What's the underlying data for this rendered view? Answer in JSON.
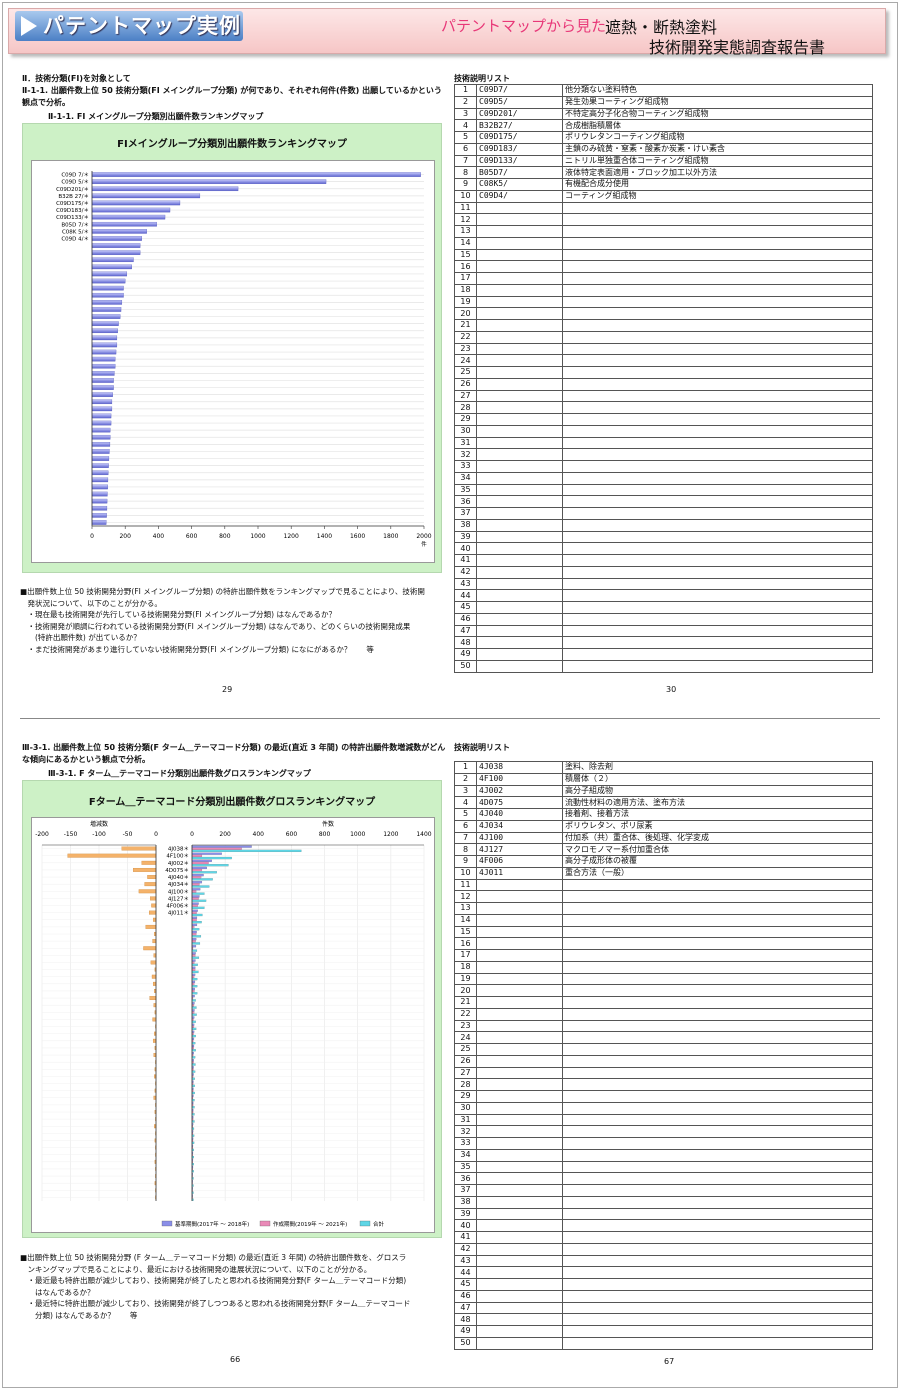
{
  "header": {
    "brand": "パテントマップ実例",
    "subtitle": "パテントマップから見た",
    "title_line1": "遮熱・断熱塗料",
    "title_line2": "技術開発実態調査報告書"
  },
  "page1": {
    "heading": "Ⅱ．技術分類(FI)を対象として",
    "desc": "Ⅱ-1-1. 出願件数上位 50 技術分類(FI メイングループ分類) が何であり、それぞれ何件(件数) 出願しているかという観点で分析。",
    "sub": "Ⅱ-1-1. FI メイングループ分類別出願件数ランキングマップ",
    "chart_title": "FIメイングループ分類別出願件数ランキングマップ",
    "notes": [
      "■出願件数上位 50 技術開発分野(FI メイングループ分類) の特許出願件数をランキングマップで見ることにより、技術開",
      "　発状況について、以下のことが分かる。",
      "　・現在最も技術開発が先行している技術開発分野(FI メイングループ分類) はなんであるか？",
      "　・技術開発が順調に行われている技術開発分野(FI メイングループ分類) はなんであり、どのくらいの技術開発成果",
      "　　(特許出願件数) が出ているか？",
      "　・まだ技術開発があまり進行していない技術開発分野(FI メイングループ分類) になにがあるか？　　等"
    ],
    "page_left": "29",
    "page_right": "30",
    "table_label": "技術説明リスト",
    "rows": [
      [
        "1",
        "C09D7/",
        "他分類ない塗料特色"
      ],
      [
        "2",
        "C09D5/",
        "発生効果コーティング組成物"
      ],
      [
        "3",
        "C09D201/",
        "不特定高分子化合物コーティング組成物"
      ],
      [
        "4",
        "B32B27/",
        "合成樹脂積層体"
      ],
      [
        "5",
        "C09D175/",
        "ポリウレタンコーティング組成物"
      ],
      [
        "6",
        "C09D183/",
        "主鎖のみ硫黄・窒素・酸素か炭素・けい素含"
      ],
      [
        "7",
        "C09D133/",
        "ニトリル単独重合体コーティング組成物"
      ],
      [
        "8",
        "B05D7/",
        "液体特定表面適用・ブロック加工以外方法"
      ],
      [
        "9",
        "C08K5/",
        "有機配合成分使用"
      ],
      [
        "10",
        "C09D4/",
        "コーティング組成物"
      ]
    ]
  },
  "page2": {
    "desc": "Ⅲ-3-1. 出願件数上位 50 技術分類(F ターム＿テーマコード分類) の最近(直近 3 年間) の特許出願件数増減数がどんな傾向にあるかという観点で分析。",
    "sub": "Ⅲ-3-1. F ターム＿テーマコード分類別出願件数グロスランキングマップ",
    "chart_title": "Fターム＿テーマコード分類別出願件数グロスランキングマップ",
    "notes": [
      "■出願件数上位 50 技術開発分野 (F ターム＿テーマコード分類) の最近(直近 3 年間) の特許出願件数を、グロスラ",
      "　ンキングマップで見ることにより、最近における技術開発の進展状況について、以下のことが分かる。",
      "　・最近最も特許出願が減少しており、技術開発が終了したと思われる技術開発分野(F ターム＿テーマコード分類)",
      "　　はなんであるか？",
      "　・最近特に特許出願が減少しており、技術開発が終了しつつあると思われる技術開発分野(F ターム＿テーマコード",
      "　　分類) はなんであるか？　　等"
    ],
    "page_left": "66",
    "page_right": "67",
    "table_label": "技術説明リスト",
    "rows": [
      [
        "1",
        "4J038",
        "塗料、除去剤"
      ],
      [
        "2",
        "4F100",
        "積層体（２）"
      ],
      [
        "3",
        "4J002",
        "高分子組成物"
      ],
      [
        "4",
        "4D075",
        "流動性材料の適用方法、塗布方法"
      ],
      [
        "5",
        "4J040",
        "接着剤、接着方法"
      ],
      [
        "6",
        "4J034",
        "ポリウレタン、ポリ尿素"
      ],
      [
        "7",
        "4J100",
        "付加系（共）重合体、後処理、化学変成"
      ],
      [
        "8",
        "4J127",
        "マクロモノマー系付加重合体"
      ],
      [
        "9",
        "4F006",
        "高分子成形体の被覆"
      ],
      [
        "10",
        "4J011",
        "重合方法（一般）"
      ]
    ]
  },
  "chart_data": [
    {
      "type": "bar",
      "title": "FIメイングループ分類別出願件数ランキングマップ",
      "categories": [
        "C09D 7/",
        "C09D 5/",
        "C09D201/",
        "B32B 27/",
        "C09D175/",
        "C09D183/",
        "C09D133/",
        "B05D 7/",
        "C08K 5/",
        "C09D 4/"
      ],
      "values": [
        1980,
        1410,
        880,
        650,
        530,
        470,
        440,
        390,
        330,
        300,
        290,
        290,
        250,
        240,
        210,
        200,
        190,
        190,
        180,
        175,
        170,
        160,
        155,
        150,
        150,
        145,
        140,
        140,
        135,
        130,
        130,
        125,
        120,
        120,
        115,
        115,
        110,
        110,
        108,
        105,
        102,
        100,
        98,
        96,
        95,
        93,
        91,
        90,
        88,
        86
      ],
      "xlim": [
        0,
        2000
      ],
      "xticks": [
        0,
        200,
        400,
        600,
        800,
        1000,
        1200,
        1400,
        1600,
        1800,
        2000
      ],
      "xunit": "件"
    },
    {
      "type": "bar",
      "title": "Fターム＿テーマコード分類別出願件数グロスランキングマップ",
      "categories": [
        "4J038",
        "4F100",
        "4J002",
        "4D075",
        "4J040",
        "4J034",
        "4J100",
        "4J127",
        "4F006",
        "4J011"
      ],
      "left_axis_label": "増減数",
      "right_axis_label": "件数",
      "left_xlim": [
        -200,
        0
      ],
      "left_xticks": [
        -200,
        -150,
        -100,
        -50,
        0
      ],
      "right_xlim": [
        0,
        1400
      ],
      "right_xticks": [
        0,
        200,
        400,
        600,
        800,
        1000,
        1200,
        1400
      ],
      "change": [
        -60,
        -155,
        -25,
        -40,
        -15,
        -20,
        -30,
        -10,
        -8,
        -12,
        -5,
        -18,
        -3,
        -6,
        -22,
        -4,
        -9,
        -2,
        -7,
        -5,
        -3,
        -11,
        -4,
        -2,
        -6,
        -1,
        -3,
        -5,
        -2,
        -4,
        -1,
        -2,
        -3,
        -1,
        -2,
        -4,
        -1,
        -2,
        -1,
        -3,
        -1,
        -2,
        -1,
        -1,
        -2,
        -1,
        -1,
        -2,
        -1,
        -1
      ],
      "series": [
        {
          "name": "基準期間(2017年 ～ 2018年)",
          "color": "#8a8ee8",
          "values": [
            360,
            180,
            120,
            90,
            70,
            60,
            50,
            45,
            40,
            35,
            30,
            30,
            28,
            26,
            24,
            22,
            21,
            20,
            19,
            18,
            17,
            16,
            15,
            15,
            14,
            13,
            13,
            12,
            12,
            11,
            11,
            10,
            10,
            9,
            9,
            9,
            8,
            8,
            8,
            7,
            7,
            7,
            6,
            6,
            6,
            6,
            5,
            5,
            5,
            5
          ]
        },
        {
          "name": "作成期間(2019年 ～ 2021年)",
          "color": "#ea8ab8",
          "values": [
            300,
            60,
            100,
            60,
            55,
            45,
            25,
            40,
            35,
            28,
            28,
            14,
            26,
            22,
            6,
            20,
            14,
            19,
            13,
            14,
            15,
            6,
            12,
            13,
            9,
            12,
            10,
            8,
            11,
            8,
            10,
            9,
            7,
            8,
            8,
            6,
            7,
            7,
            7,
            5,
            6,
            6,
            5,
            5,
            5,
            5,
            4,
            4,
            4,
            4
          ]
        },
        {
          "name": "合計",
          "color": "#5ed6e6",
          "values": [
            660,
            240,
            220,
            150,
            125,
            105,
            75,
            85,
            75,
            63,
            58,
            44,
            54,
            48,
            30,
            42,
            35,
            39,
            32,
            32,
            32,
            22,
            27,
            28,
            23,
            25,
            23,
            20,
            23,
            19,
            21,
            19,
            17,
            17,
            17,
            15,
            15,
            15,
            15,
            12,
            13,
            13,
            11,
            11,
            11,
            11,
            9,
            9,
            9,
            9
          ]
        }
      ]
    }
  ]
}
